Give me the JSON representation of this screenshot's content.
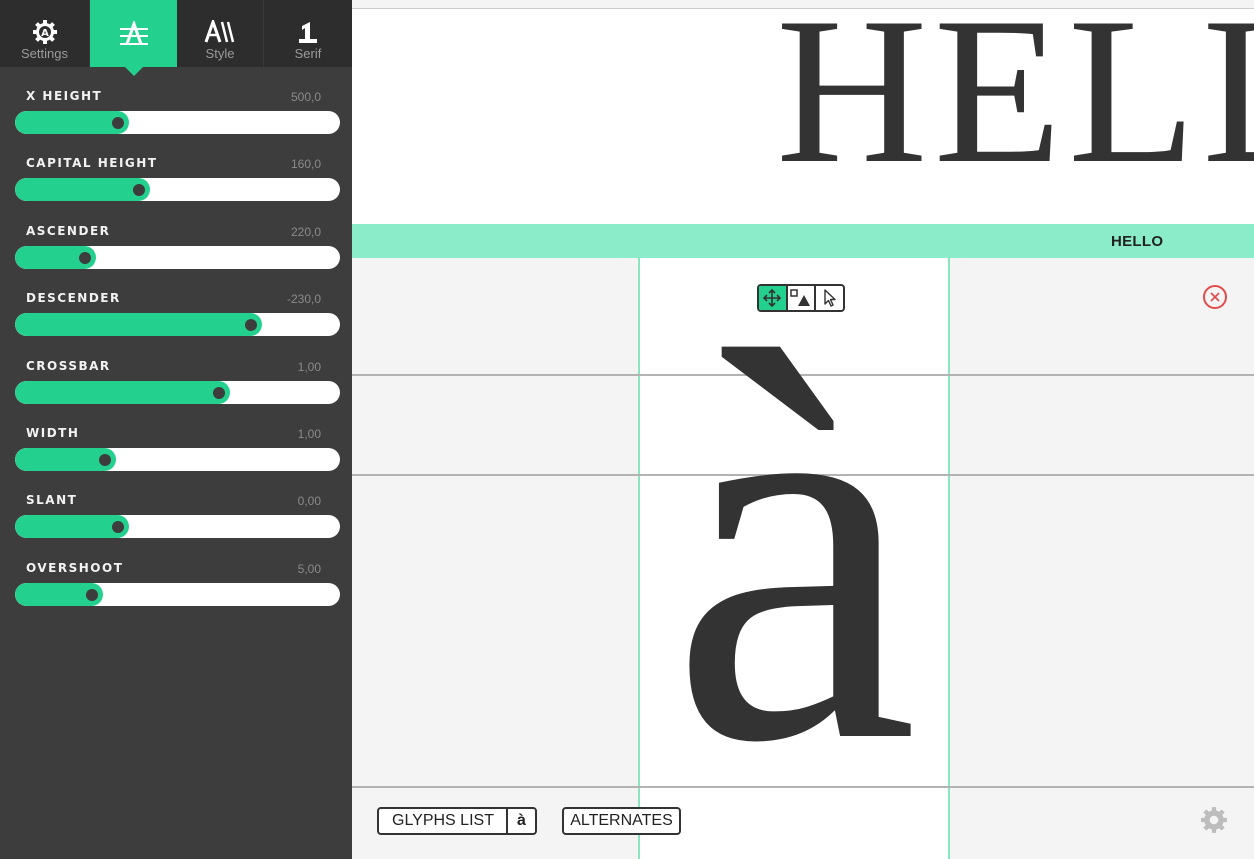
{
  "sidebar": {
    "tabs": [
      {
        "label": "Settings",
        "icon": "settings-gear-icon"
      },
      {
        "label": "",
        "icon": "font-metrics-icon",
        "active": true
      },
      {
        "label": "Style",
        "icon": "style-icon"
      },
      {
        "label": "Serif",
        "icon": "serif-icon"
      }
    ],
    "params": [
      {
        "label": "X HEIGHT",
        "value": "500,0",
        "level": 0.35
      },
      {
        "label": "CAPITAL HEIGHT",
        "value": "160,0",
        "level": 0.415
      },
      {
        "label": "ASCENDER",
        "value": "220,0",
        "level": 0.25
      },
      {
        "label": "DESCENDER",
        "value": "-230,0",
        "level": 0.76
      },
      {
        "label": "CROSSBAR",
        "value": "1,00",
        "level": 0.66
      },
      {
        "label": "WIDTH",
        "value": "1,00",
        "level": 0.31
      },
      {
        "label": "SLANT",
        "value": "0,00",
        "level": 0.35
      },
      {
        "label": "OVERSHOOT",
        "value": "5,00",
        "level": 0.27
      }
    ]
  },
  "preview": {
    "text": "HELLO"
  },
  "strip": {
    "word": "HELLO"
  },
  "editor": {
    "glyph": "à",
    "tools": [
      "move-icon",
      "shape-icon",
      "pointer-icon"
    ],
    "active_tool": "move-icon"
  },
  "footer": {
    "glyphs_list_label": "GLYPHS LIST",
    "current_glyph": "à",
    "alternates_label": "ALTERNATES"
  },
  "colors": {
    "accent": "#24d08e",
    "strip": "#8aecc8",
    "close": "#e34b4b",
    "sidebar": "#3d3d3d"
  }
}
